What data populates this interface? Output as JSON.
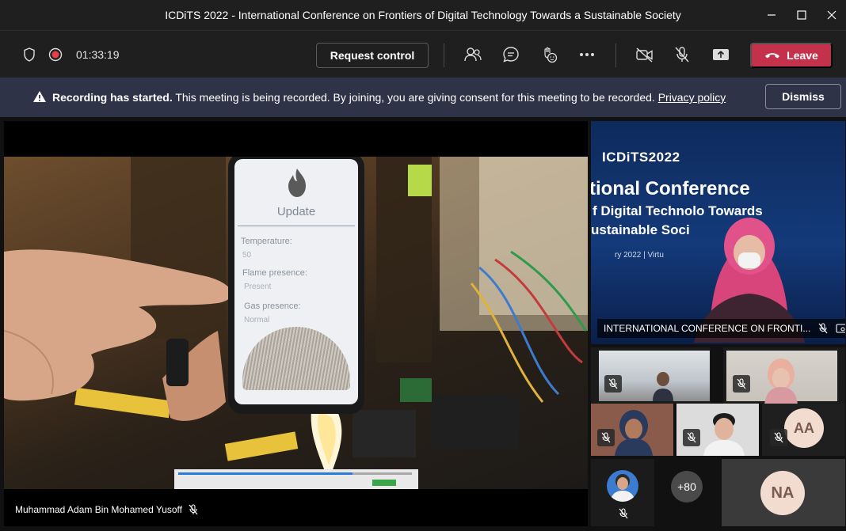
{
  "window": {
    "title": "ICDiTS 2022 - International Conference on Frontiers of Digital Technology Towards a Sustainable Society",
    "controls": [
      "minimize",
      "maximize",
      "close"
    ]
  },
  "toolbar": {
    "timer": "01:33:19",
    "request_control_label": "Request control",
    "leave_label": "Leave",
    "icons": [
      "shield-icon",
      "record-icon",
      "participants-icon",
      "chat-icon",
      "reactions-icon",
      "more-icon",
      "camera-off-icon",
      "mic-off-icon",
      "share-icon",
      "phone-icon"
    ],
    "colors": {
      "leave": "#c4314b",
      "record": "#e8404b"
    }
  },
  "banner": {
    "bold": "Recording has started.",
    "message": "This meeting is being recorded. By joining, you are giving consent for this meeting to be recorded.",
    "link": "Privacy policy",
    "dismiss_label": "Dismiss",
    "color": "#2f3348"
  },
  "main_video": {
    "presenter": "Muhammad Adam Bin Mohamed Yusoff",
    "phone_screen": {
      "heading": "Update",
      "temperature_label": "Temperature:",
      "temperature_value": "50",
      "flame_label": "Flame presence:",
      "flame_value": "Present",
      "gas_label": "Gas presence:",
      "gas_value": "Normal"
    }
  },
  "featured": {
    "logo": "ICDiTS2022",
    "slide_line1": "tional Conference",
    "slide_line2": "f Digital Technolo  Towards",
    "slide_line3": "ustainable Soci",
    "slide_line4": "ry 2022 | Virtu",
    "label": "INTERNATIONAL CONFERENCE ON FRONTI..."
  },
  "participants": {
    "initials_1": "AA",
    "initials_2": "NA",
    "overflow": "+80"
  }
}
